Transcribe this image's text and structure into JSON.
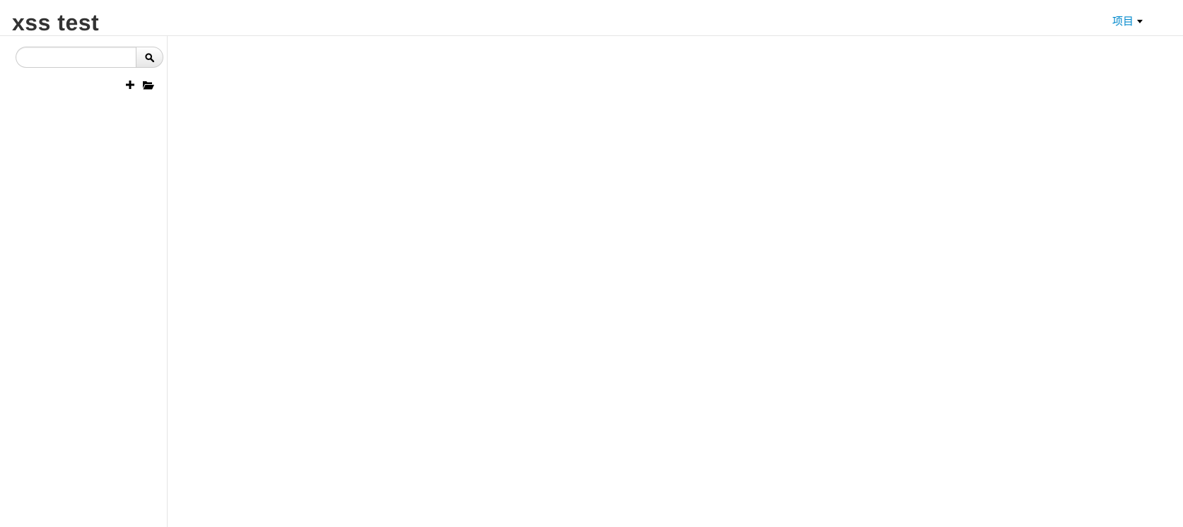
{
  "header": {
    "title": "xss test",
    "project_menu_label": "项目",
    "caret_icon": "caret-down-icon"
  },
  "sidebar": {
    "search": {
      "value": "",
      "placeholder": "",
      "button_icon": "search-icon"
    },
    "tools": [
      {
        "icon": "plus-icon"
      },
      {
        "icon": "folder-open-icon"
      }
    ]
  },
  "colors": {
    "link": "#0088cc",
    "text": "#333333",
    "border": "#e5e5e5"
  }
}
